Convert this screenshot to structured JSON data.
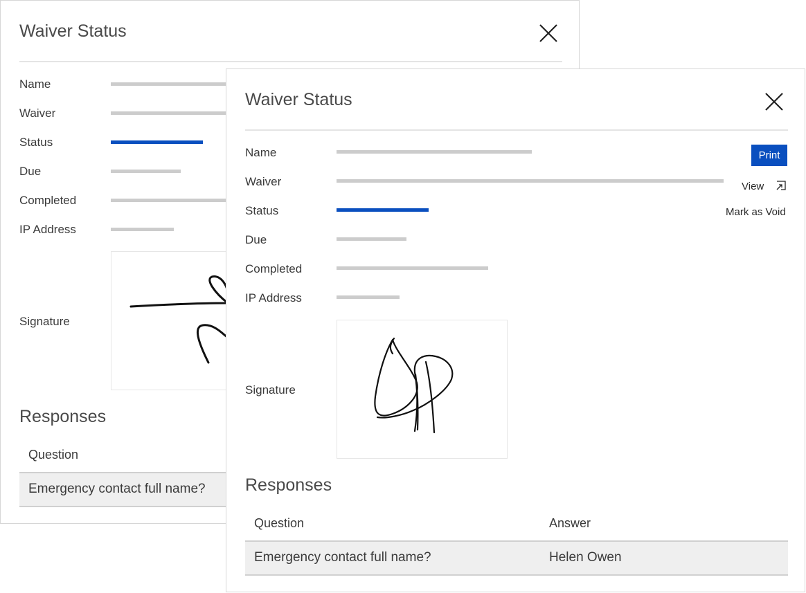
{
  "back_dialog": {
    "title": "Waiver Status",
    "fields": {
      "name": "Name",
      "waiver": "Waiver",
      "status": "Status",
      "due": "Due",
      "completed": "Completed",
      "ip_address": "IP Address",
      "signature": "Signature"
    },
    "responses_title": "Responses",
    "table": {
      "columns": [
        "Question"
      ],
      "rows": [
        [
          "Emergency contact full name?"
        ]
      ]
    }
  },
  "front_dialog": {
    "title": "Waiver Status",
    "fields": {
      "name": "Name",
      "waiver": "Waiver",
      "status": "Status",
      "due": "Due",
      "completed": "Completed",
      "ip_address": "IP Address",
      "signature": "Signature"
    },
    "actions": {
      "print": "Print",
      "view": "View",
      "mark_void": "Mark as Void"
    },
    "responses_title": "Responses",
    "table": {
      "columns": [
        "Question",
        "Answer"
      ],
      "rows": [
        [
          "Emergency contact full name?",
          "Helen Owen"
        ]
      ]
    }
  },
  "colors": {
    "accent": "#0a4fbf",
    "placeholder_bar": "#cccccc",
    "row_background": "#efefef"
  },
  "icons": [
    "close-icon",
    "external-link-icon"
  ]
}
